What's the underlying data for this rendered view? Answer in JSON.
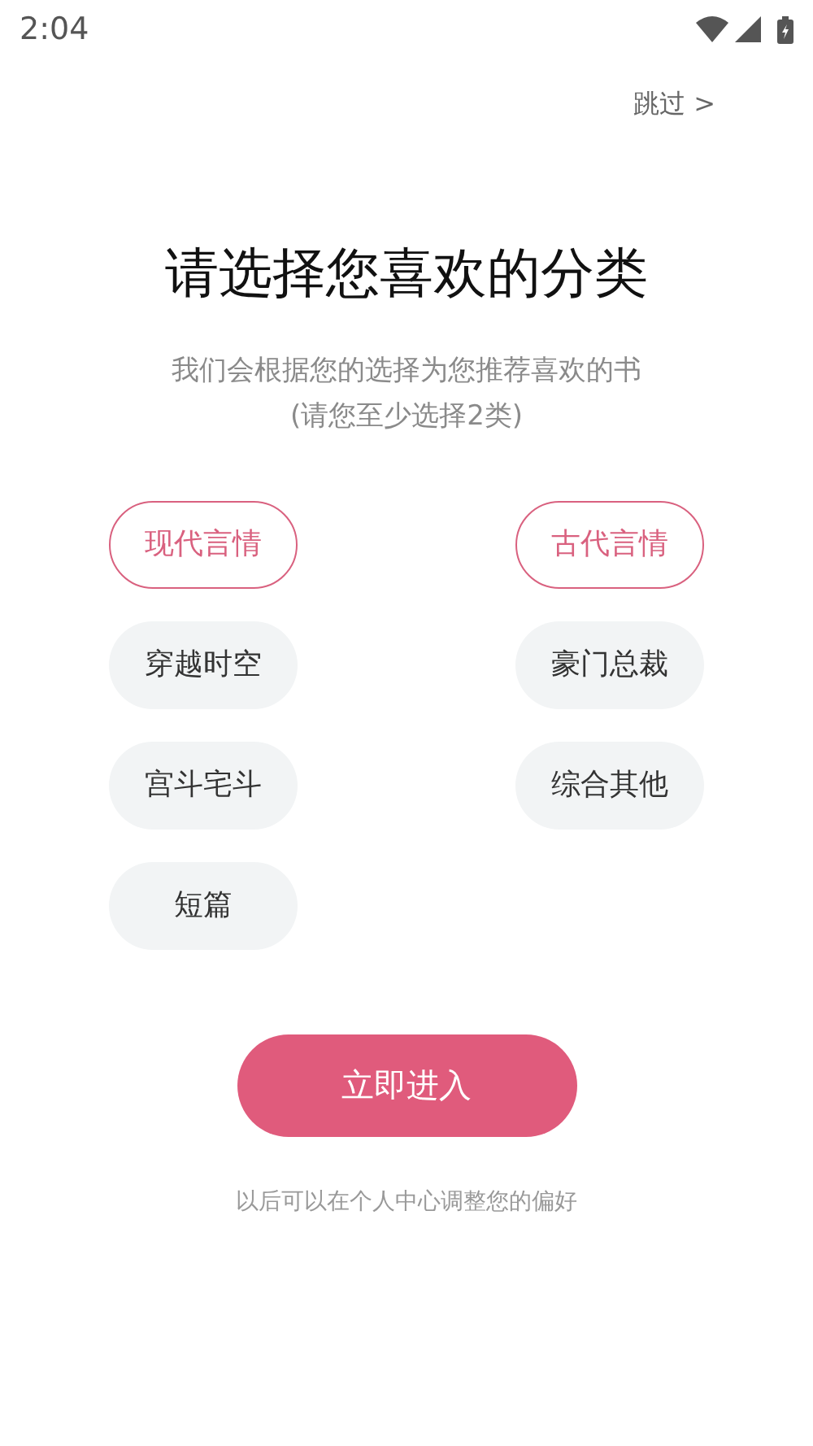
{
  "status_bar": {
    "time": "2:04"
  },
  "skip": "跳过 >",
  "title": "请选择您喜欢的分类",
  "subtitle": [
    "我们会根据您的选择为您推荐喜欢的书",
    "(请您至少选择2类)"
  ],
  "categories": [
    {
      "label": "现代言情",
      "selected": true
    },
    {
      "label": "古代言情",
      "selected": true
    },
    {
      "label": "穿越时空",
      "selected": false
    },
    {
      "label": "豪门总裁",
      "selected": false
    },
    {
      "label": "宫斗宅斗",
      "selected": false
    },
    {
      "label": "综合其他",
      "selected": false
    },
    {
      "label": "短篇",
      "selected": false
    }
  ],
  "enter_button": "立即进入",
  "footer_note": "以后可以在个人中心调整您的偏好"
}
